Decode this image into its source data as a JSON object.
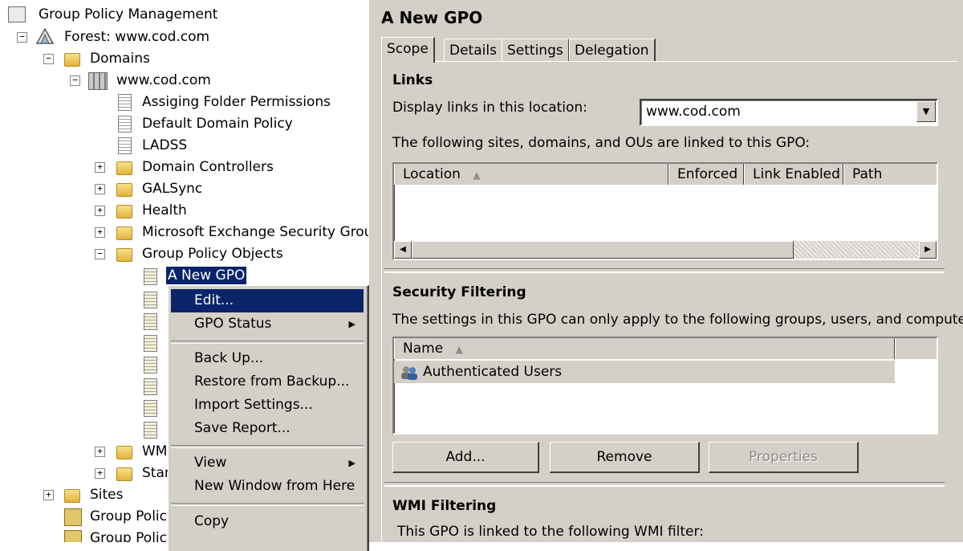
{
  "tree": {
    "root": "Group Policy Management",
    "forest": "Forest: www.cod.com",
    "domains": "Domains",
    "domain": "www.cod.com",
    "items": {
      "assiging": "Assiging Folder Permissions",
      "default_policy": "Default Domain Policy",
      "ladss": "LADSS",
      "domain_controllers": "Domain Controllers",
      "galsync": "GALSync",
      "health": "Health",
      "exchange": "Microsoft Exchange Security Grou",
      "gpo_folder": "Group Policy Objects",
      "new_gpo": "A New GPO",
      "wmi_partial": "WM",
      "starter_partial": "Star",
      "sites": "Sites",
      "gp_modeling_partial": "Group Policy",
      "gp_results_partial": "Group Policy"
    }
  },
  "context_menu": {
    "items": [
      {
        "label": "Edit...",
        "selected": true,
        "submenu": false
      },
      {
        "label": "GPO Status",
        "selected": false,
        "submenu": true
      },
      {
        "label": "Back Up...",
        "selected": false,
        "submenu": false
      },
      {
        "label": "Restore from Backup...",
        "selected": false,
        "submenu": false
      },
      {
        "label": "Import Settings...",
        "selected": false,
        "submenu": false
      },
      {
        "label": "Save Report...",
        "selected": false,
        "submenu": false
      },
      {
        "label": "View",
        "selected": false,
        "submenu": true
      },
      {
        "label": "New Window from Here",
        "selected": false,
        "submenu": false
      },
      {
        "label": "Copy",
        "selected": false,
        "submenu": false
      }
    ],
    "submenu_glyph": "▶"
  },
  "details": {
    "title": "A New GPO",
    "tabs": [
      "Scope",
      "Details",
      "Settings",
      "Delegation"
    ],
    "active_tab": "Scope",
    "links": {
      "heading": "Links",
      "display_label": "Display links in this location:",
      "location_value": "www.cod.com",
      "linked_text": "The following sites, domains, and OUs are linked to this GPO:",
      "columns": [
        "Location",
        "Enforced",
        "Link Enabled",
        "Path"
      ]
    },
    "security": {
      "heading": "Security Filtering",
      "description": "The settings in this GPO can only apply to the following groups, users, and computers:",
      "column": "Name",
      "entries": [
        "Authenticated Users"
      ],
      "buttons": {
        "add": "Add...",
        "remove": "Remove",
        "properties": "Properties"
      }
    },
    "wmi": {
      "heading": "WMI Filtering",
      "description": "This GPO is linked to the following WMI filter:"
    }
  },
  "colors": {
    "selection": "#0a246a",
    "dialog_bg": "#d4d0c8"
  }
}
